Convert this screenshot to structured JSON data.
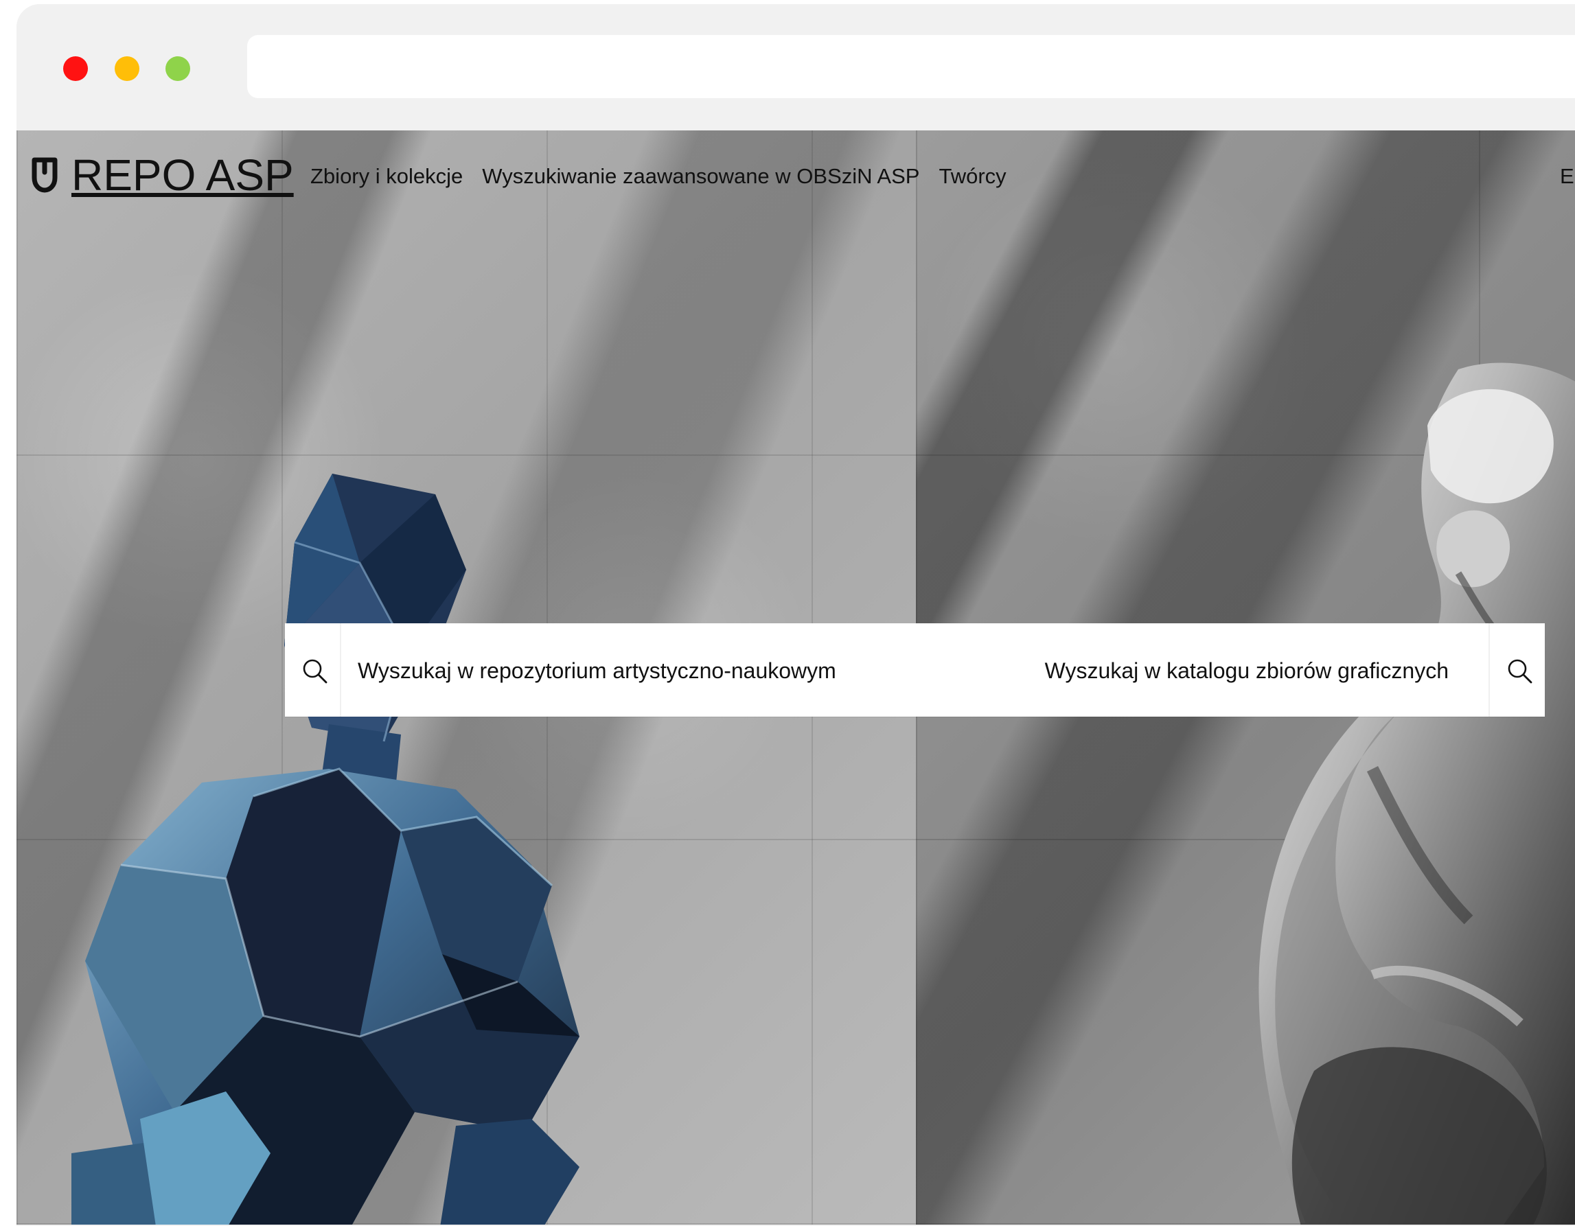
{
  "browser": {
    "address_value": ""
  },
  "site": {
    "brand": "REPO ASP",
    "nav": [
      {
        "label": "Zbiory i kolekcje"
      },
      {
        "label": "Wyszukiwanie zaawansowane w OBSziN ASP"
      },
      {
        "label": "Twórcy"
      }
    ],
    "language": "EN"
  },
  "search": {
    "repository_placeholder": "Wyszukaj w repozytorium artystyczno-naukowym",
    "catalog_placeholder": "Wyszukaj w katalogu zbiorów graficznych",
    "left_icon": "search-icon",
    "right_icon": "search-icon"
  },
  "colors": {
    "red_control": "#ff1212",
    "yellow_control": "#ffbe08",
    "green_control": "#8fd34a",
    "header_text": "#111111",
    "search_background": "#ffffff",
    "poly_sculpture": "#25384f",
    "stone_sculpture": "#d8d8d8"
  },
  "icons": {
    "brand": "shield-icon",
    "search": "search-icon"
  }
}
